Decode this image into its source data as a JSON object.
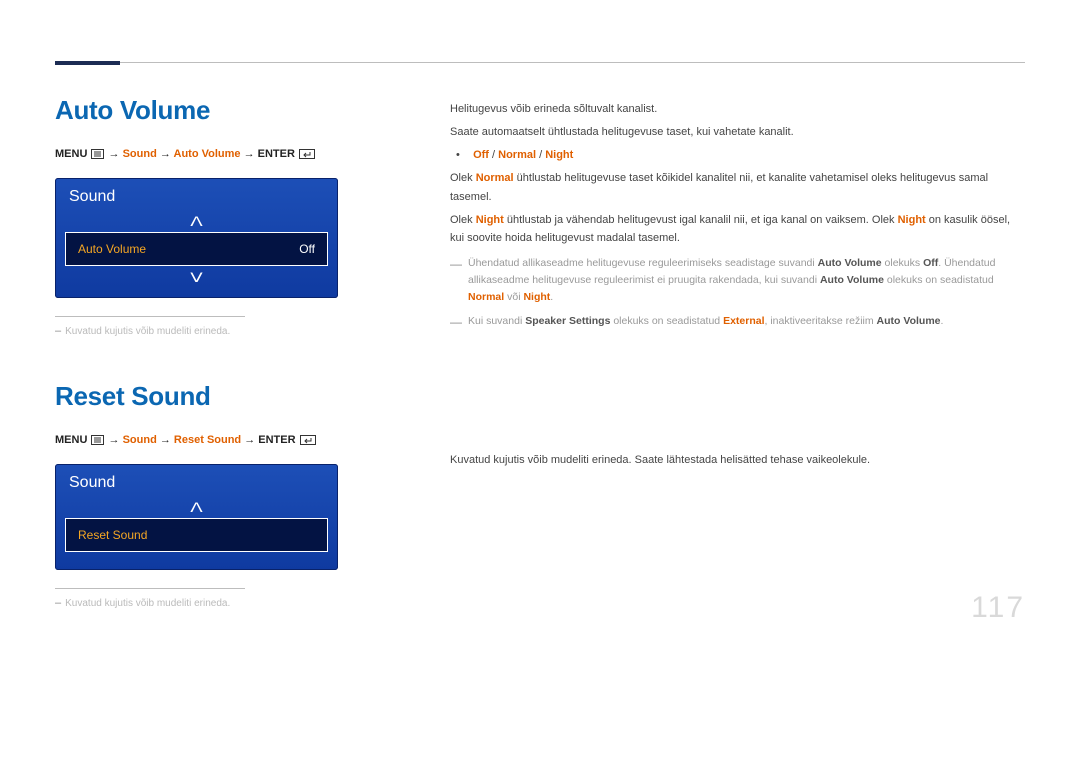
{
  "page_number": "117",
  "sections": {
    "auto_volume": {
      "heading": "Auto Volume",
      "breadcrumb": {
        "menu": "MENU",
        "arrow": "→",
        "sound": "Sound",
        "item": "Auto Volume",
        "enter": "ENTER"
      },
      "panel": {
        "title": "Sound",
        "row_label": "Auto Volume",
        "row_value": "Off"
      },
      "footnote": "Kuvatud kujutis võib mudeliti erineda."
    },
    "reset_sound": {
      "heading": "Reset Sound",
      "breadcrumb": {
        "menu": "MENU",
        "arrow": "→",
        "sound": "Sound",
        "item": "Reset Sound",
        "enter": "ENTER"
      },
      "panel": {
        "title": "Sound",
        "row_label": "Reset Sound"
      },
      "footnote": "Kuvatud kujutis võib mudeliti erineda."
    }
  },
  "right": {
    "p1": "Helitugevus võib erineda sõltuvalt kanalist.",
    "p2": "Saate automaatselt ühtlustada helitugevuse taset, kui vahetate kanalit.",
    "options": {
      "off": "Off",
      "sep": " / ",
      "normal": "Normal",
      "night": "Night"
    },
    "p3a": "Olek ",
    "p3b": "Normal",
    "p3c": " ühtlustab helitugevuse taset kõikidel kanalitel nii, et kanalite vahetamisel oleks helitugevus samal tasemel.",
    "p4a": "Olek ",
    "p4b": "Night",
    "p4c": " ühtlustab ja vähendab helitugevust igal kanalil nii, et iga kanal on vaiksem. Olek ",
    "p4d": "Night",
    "p4e": " on kasulik öösel, kui soovite hoida helitugevust madalal tasemel.",
    "note1": {
      "a": "Ühendatud allikaseadme helitugevuse reguleerimiseks seadistage suvandi ",
      "b": "Auto Volume",
      "c": " olekuks ",
      "d": "Off",
      "e": ". Ühendatud allikaseadme helitugevuse reguleerimist ei pruugita rakendada, kui suvandi ",
      "f": "Auto Volume",
      "g": " olekuks on seadistatud ",
      "h": "Normal",
      "i": " või ",
      "j": "Night",
      "k": "."
    },
    "note2": {
      "a": "Kui suvandi ",
      "b": "Speaker Settings",
      "c": " olekuks on seadistatud ",
      "d": "External",
      "e": ", inaktiveeritakse režiim ",
      "f": "Auto Volume",
      "g": "."
    },
    "reset_p": "Kuvatud kujutis võib mudeliti erineda. Saate lähtestada helisätted tehase vaikeolekule."
  }
}
